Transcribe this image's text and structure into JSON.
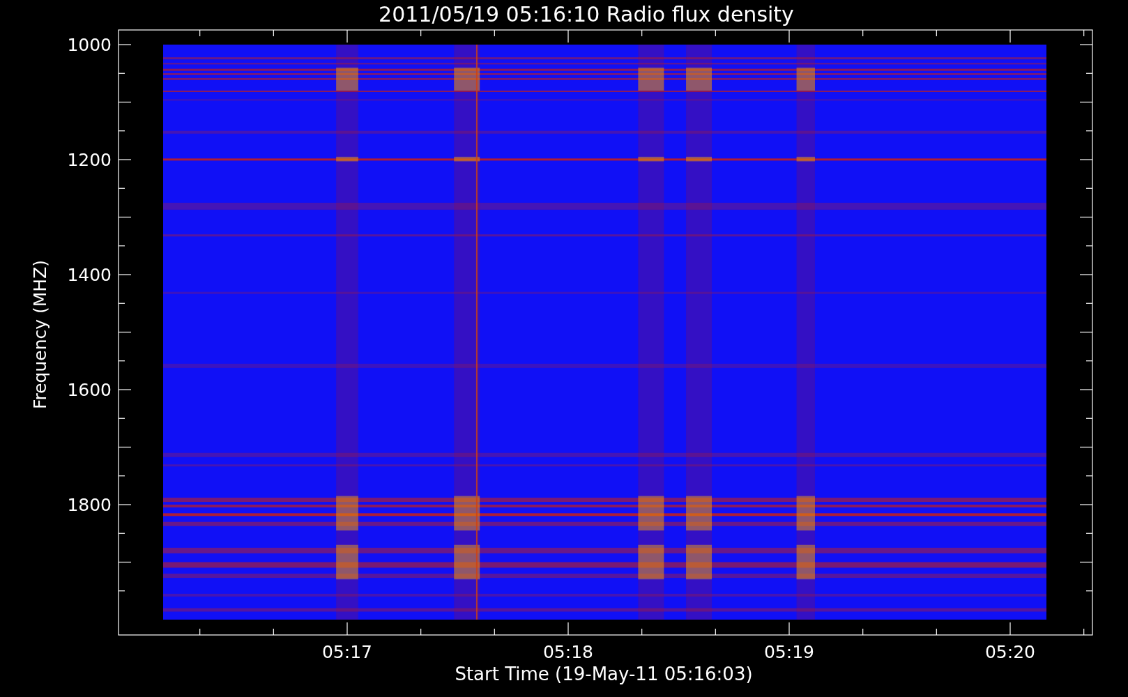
{
  "title": "2011/05/19 05:16:10 Radio flux density",
  "y_axis": {
    "label": "Frequency (MHZ)",
    "tick_labels": [
      "1000",
      "1200",
      "1400",
      "1600",
      "1800"
    ]
  },
  "x_axis": {
    "label": "Start Time (19-May-11 05:16:03)",
    "tick_labels": [
      "05:17",
      "05:18",
      "05:19",
      "05:20"
    ]
  }
}
